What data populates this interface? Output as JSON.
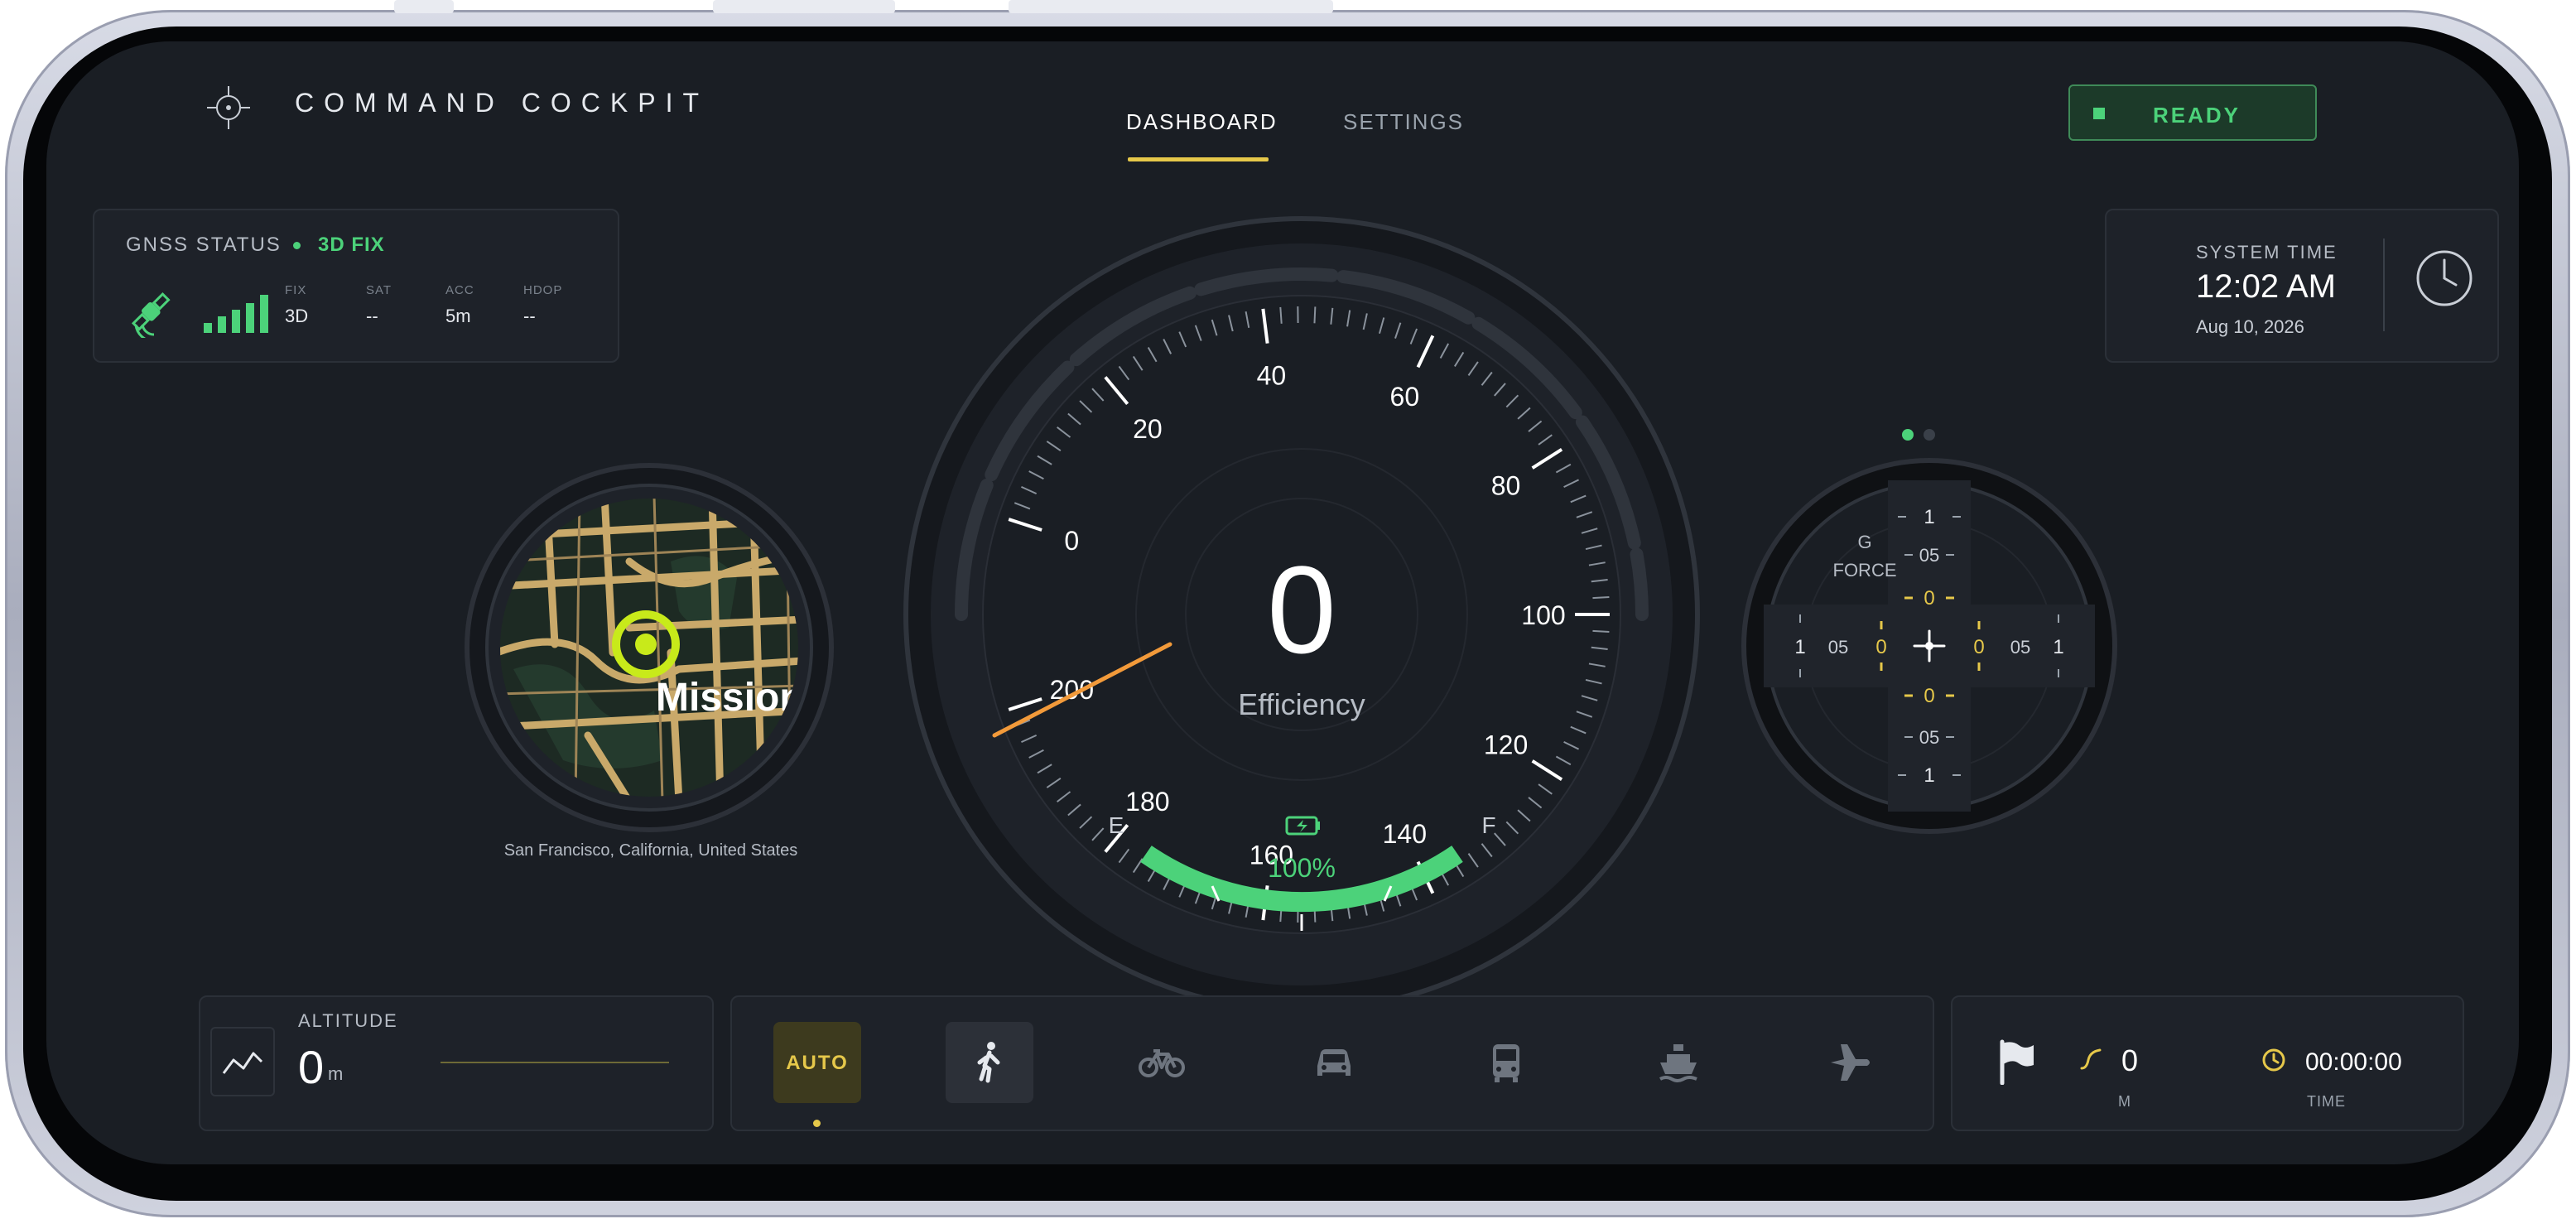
{
  "header": {
    "app_title": "COMMAND COCKPIT",
    "tabs": [
      {
        "label": "DASHBOARD",
        "active": true
      },
      {
        "label": "SETTINGS",
        "active": false
      }
    ],
    "status_button": "READY"
  },
  "gnss": {
    "title": "GNSS STATUS",
    "fix_status": "3D FIX",
    "stats": [
      {
        "label": "FIX",
        "value": "3D"
      },
      {
        "label": "SAT",
        "value": "--"
      },
      {
        "label": "ACC",
        "value": "5m"
      },
      {
        "label": "HDOP",
        "value": "--"
      }
    ]
  },
  "system_time": {
    "label": "SYSTEM TIME",
    "time": "12:02 AM",
    "date": "Aug 10, 2026"
  },
  "map": {
    "label": "Mission",
    "location": "San Francisco, California, United States"
  },
  "gauge": {
    "value": "0",
    "label": "Efficiency",
    "scale_labels": [
      "0",
      "20",
      "40",
      "60",
      "80",
      "100",
      "120",
      "140",
      "160",
      "180",
      "200"
    ],
    "fuel_empty": "E",
    "fuel_full": "F",
    "battery_percent": "100%",
    "battery_label": "BATTERY",
    "battery_level": 1.0
  },
  "gforce": {
    "label_top": "G",
    "label_bottom": "FORCE",
    "vertical_ticks": [
      "1",
      "05",
      "0",
      "0",
      "05",
      "1"
    ],
    "horizontal_ticks": [
      "1",
      "05",
      "0",
      "0",
      "05",
      "1"
    ]
  },
  "altitude": {
    "label": "ALTITUDE",
    "value": "0",
    "unit": "m"
  },
  "modes": {
    "auto_label": "AUTO",
    "items": [
      "walk-icon",
      "bicycle-icon",
      "car-icon",
      "bus-icon",
      "ship-icon",
      "plane-icon"
    ]
  },
  "trip": {
    "distance": "0",
    "distance_unit": "M",
    "time": "00:00:00",
    "time_unit": "TIME"
  },
  "colors": {
    "accent_yellow": "#e6c84a",
    "status_green": "#4cd27a",
    "needle_orange": "#f29a3a",
    "target_lime": "#c8ea1a"
  }
}
